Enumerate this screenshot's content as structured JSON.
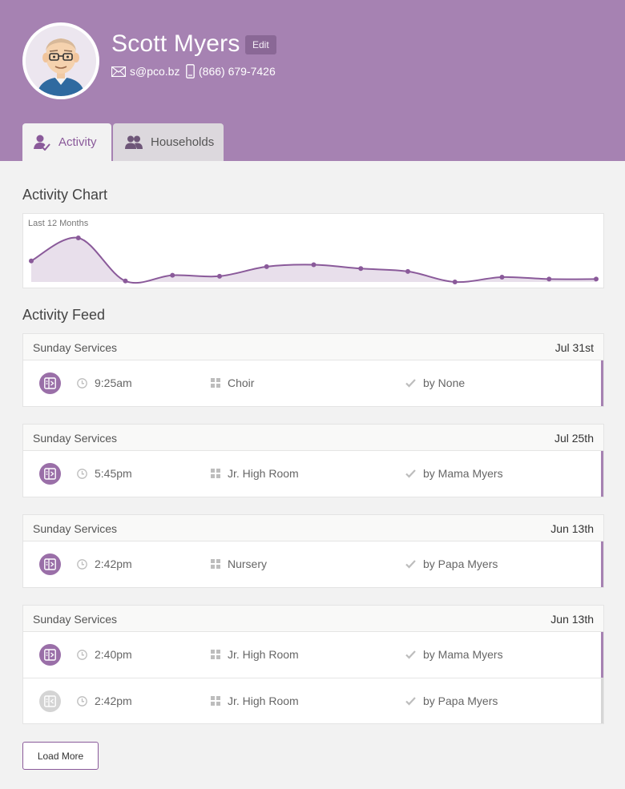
{
  "profile": {
    "name": "Scott Myers",
    "edit_label": "Edit",
    "email": "s@pco.bz",
    "phone": "(866) 679-7426",
    "avatar_icon": "cartoon-avatar"
  },
  "tabs": [
    {
      "label": "Activity",
      "icon": "person-check-icon",
      "active": true
    },
    {
      "label": "Households",
      "icon": "people-icon",
      "active": false
    }
  ],
  "activity_chart": {
    "title": "Activity Chart",
    "caption": "Last 12 Months",
    "chart_data": {
      "type": "area",
      "points": 13,
      "values": [
        2.2,
        4.6,
        0.1,
        0.7,
        0.6,
        1.6,
        1.8,
        1.4,
        1.1,
        0.0,
        0.5,
        0.3,
        0.3
      ]
    }
  },
  "feed": {
    "title": "Activity Feed",
    "groups": [
      {
        "event": "Sunday Services",
        "date": "Jul 31st",
        "rows": [
          {
            "time": "9:25am",
            "location": "Choir",
            "by": "by None",
            "faded": false
          }
        ]
      },
      {
        "event": "Sunday Services",
        "date": "Jul 25th",
        "rows": [
          {
            "time": "5:45pm",
            "location": "Jr. High Room",
            "by": "by Mama Myers",
            "faded": false
          }
        ]
      },
      {
        "event": "Sunday Services",
        "date": "Jun 13th",
        "rows": [
          {
            "time": "2:42pm",
            "location": "Nursery",
            "by": "by Papa Myers",
            "faded": false
          }
        ]
      },
      {
        "event": "Sunday Services",
        "date": "Jun 13th",
        "rows": [
          {
            "time": "2:40pm",
            "location": "Jr. High Room",
            "by": "by Mama Myers",
            "faded": false
          },
          {
            "time": "2:42pm",
            "location": "Jr. High Room",
            "by": "by Papa Myers",
            "faded": true
          }
        ]
      }
    ],
    "load_more_label": "Load More"
  },
  "colors": {
    "brand": "#a682b2",
    "accent": "#9a6fa8",
    "chart_line": "#8a5a9a",
    "chart_fill": "#e8dfeb"
  }
}
